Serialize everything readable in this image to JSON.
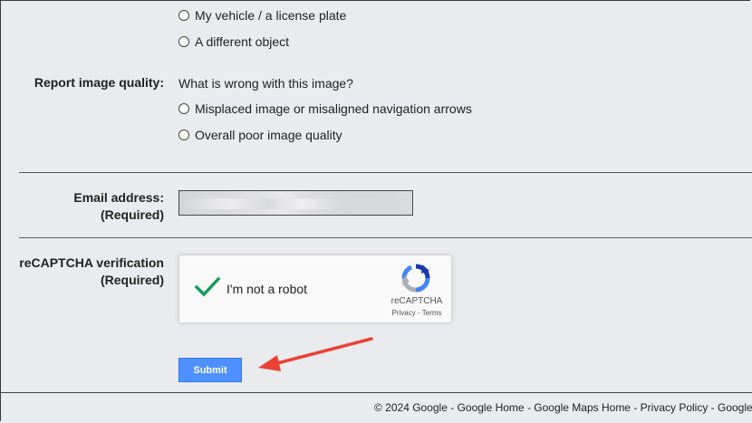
{
  "report_section": {
    "options_top": [
      {
        "label": "My vehicle / a license plate"
      },
      {
        "label": "A different object"
      }
    ]
  },
  "image_quality": {
    "label": "Report image quality:",
    "question": "What is wrong with this image?",
    "options": [
      {
        "label": "Misplaced image or misaligned navigation arrows"
      },
      {
        "label": "Overall poor image quality"
      }
    ]
  },
  "email": {
    "label_line1": "Email address:",
    "label_line2": "(Required)",
    "value": ""
  },
  "recaptcha": {
    "label_line1": "reCAPTCHA verification",
    "label_line2": "(Required)",
    "checkbox_label": "I'm not a robot",
    "brand": "reCAPTCHA",
    "links": "Privacy - Terms",
    "checked": true
  },
  "submit": {
    "label": "Submit",
    "color": "#4d90fe"
  },
  "annotation": {
    "arrow_color": "#ea4335"
  },
  "footer": {
    "text": "© 2024 Google - Google Home - Google Maps Home - Privacy Policy - Google"
  }
}
